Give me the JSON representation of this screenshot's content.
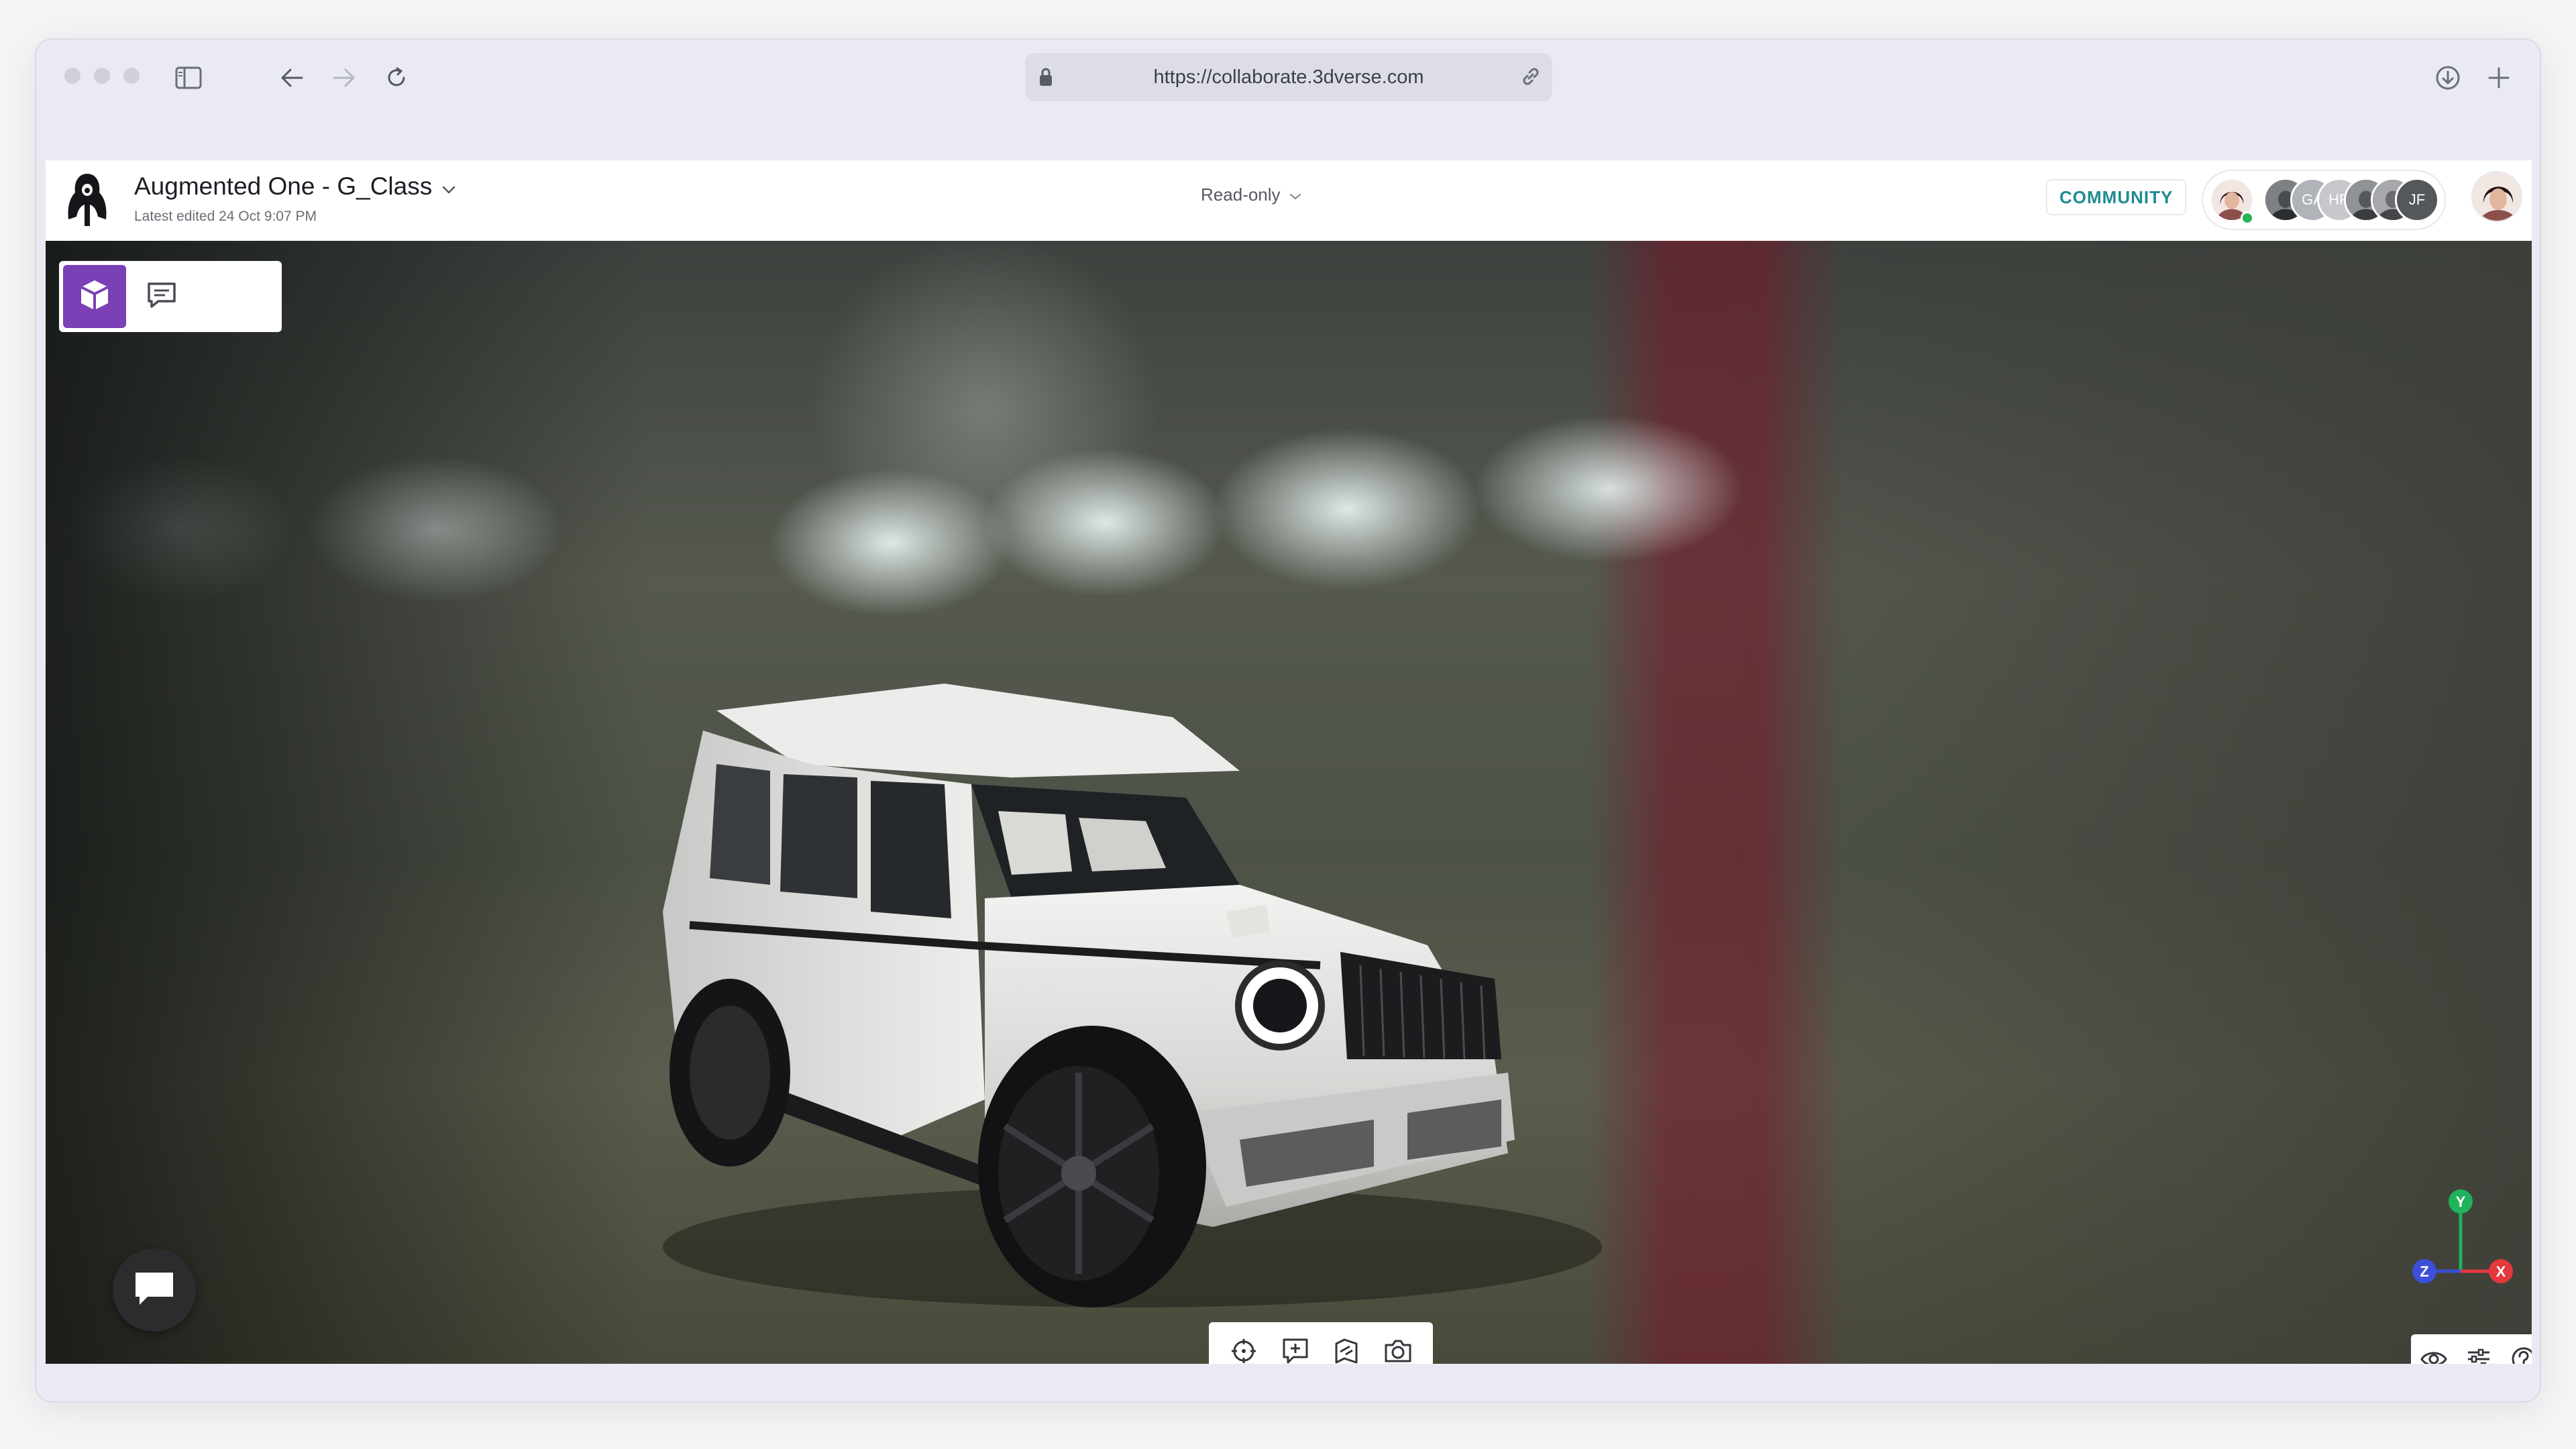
{
  "browser": {
    "url": "https://collaborate.3dverse.com"
  },
  "app": {
    "project_title": "Augmented One - G_Class",
    "last_edited": "Latest edited 24 Oct 9:07 PM",
    "access_mode": "Read-only",
    "community_label": "COMMUNITY",
    "collaborators": [
      {
        "initials": "",
        "color": "#c9a3a0",
        "online": true
      },
      {
        "initials": "",
        "color": "#5a5d62",
        "online": false
      },
      {
        "initials": "GA",
        "color": "#b0b3b8",
        "online": false
      },
      {
        "initials": "HR",
        "color": "#c7c8cc",
        "online": false
      },
      {
        "initials": "",
        "color": "#6a6c70",
        "online": false
      },
      {
        "initials": "",
        "color": "#4f5256",
        "online": false
      },
      {
        "initials": "JF",
        "color": "#54575c",
        "online": false
      }
    ],
    "accent_color": "#7b3fb6",
    "community_color": "#1e8c93"
  },
  "viewport": {
    "side_tabs": [
      {
        "icon": "cube-icon",
        "active": true
      },
      {
        "icon": "comment-icon",
        "active": false
      }
    ],
    "bottom_tools": [
      "crosshair-icon",
      "add-comment-icon",
      "perspective-icon",
      "camera-icon"
    ],
    "view_controls": [
      "eye-icon",
      "sliders-icon",
      "help-icon"
    ],
    "axes": {
      "y": "Y",
      "x": "X",
      "z": "Z"
    }
  }
}
